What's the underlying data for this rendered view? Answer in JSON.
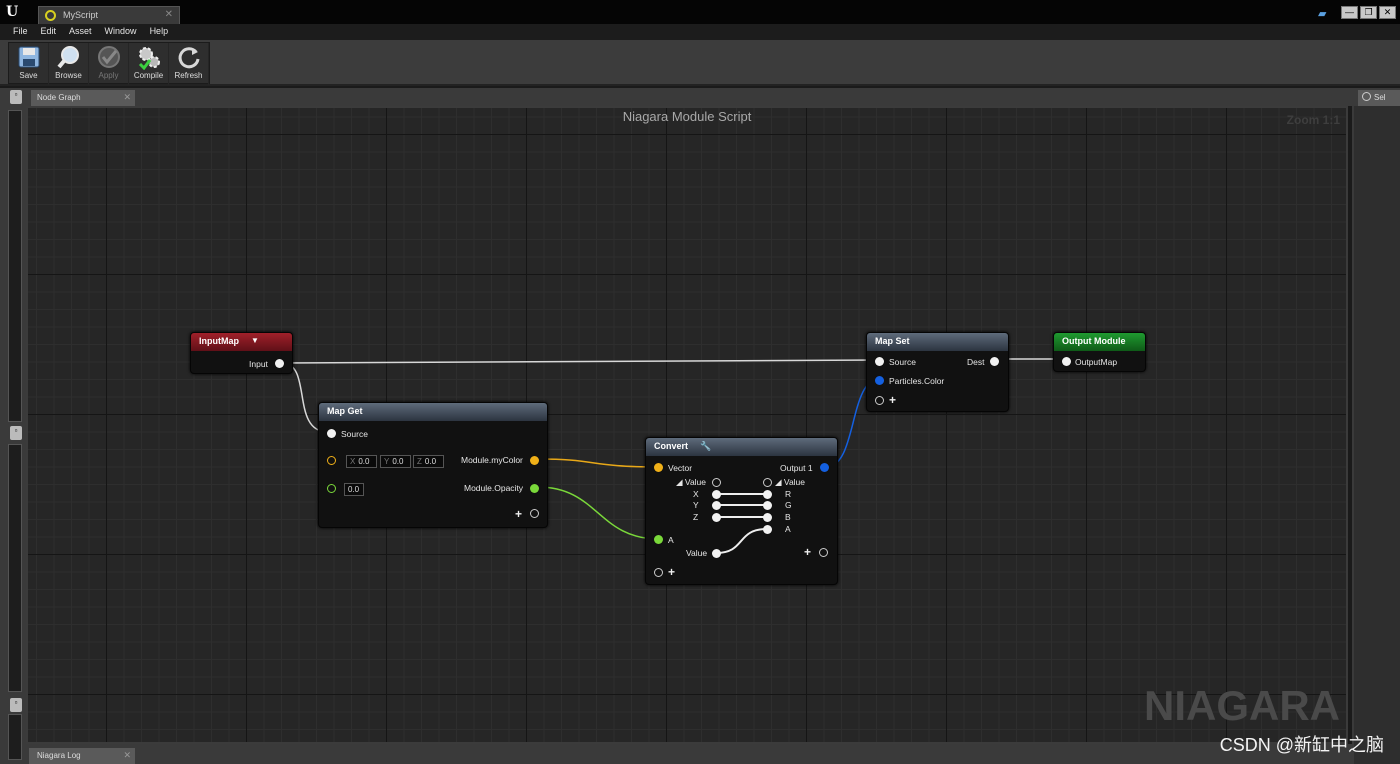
{
  "window": {
    "logo": "U",
    "doc_tab": "MyScript",
    "minimize": "—",
    "restore": "❐",
    "close": "✕"
  },
  "menu": [
    "File",
    "Edit",
    "Asset",
    "Window",
    "Help"
  ],
  "toolbar": {
    "save": "Save",
    "browse": "Browse",
    "apply": "Apply",
    "compile": "Compile",
    "refresh": "Refresh"
  },
  "graph_tab": "Node Graph",
  "graph": {
    "title": "Niagara Module Script",
    "zoom": "Zoom 1:1",
    "watermark": "NIAGARA"
  },
  "nodes": {
    "input_map": {
      "title": "InputMap",
      "output": "Input"
    },
    "map_get": {
      "title": "Map Get",
      "source": "Source",
      "x": "0.0",
      "y": "0.0",
      "z": "0.0",
      "opacity_default": "0.0",
      "out_color": "Module.myColor",
      "out_opacity": "Module.Opacity"
    },
    "convert": {
      "title": "Convert",
      "in_vector": "Vector",
      "in_value": "Value",
      "in_x": "X",
      "in_y": "Y",
      "in_z": "Z",
      "in_a": "A",
      "out_value_bottom": "Value",
      "out_output": "Output 1",
      "out_value": "Value",
      "out_r": "R",
      "out_g": "G",
      "out_b": "B",
      "out_a": "A"
    },
    "map_set": {
      "title": "Map Set",
      "source": "Source",
      "dest": "Dest",
      "particles_color": "Particles.Color"
    },
    "output_module": {
      "title": "Output Module",
      "input": "OutputMap"
    }
  },
  "right_tab": "Sel",
  "log_tab": "Niagara Log",
  "credit": "CSDN @新缸中之脑",
  "colors": {
    "input_map_header": "#a0202a",
    "map_header": "#5e6b7b",
    "output_header": "#1f9a30",
    "wire_white": "#d8d8d8",
    "wire_yellow": "#e8a818",
    "wire_green": "#7ad83a",
    "wire_blue": "#1460e0"
  }
}
